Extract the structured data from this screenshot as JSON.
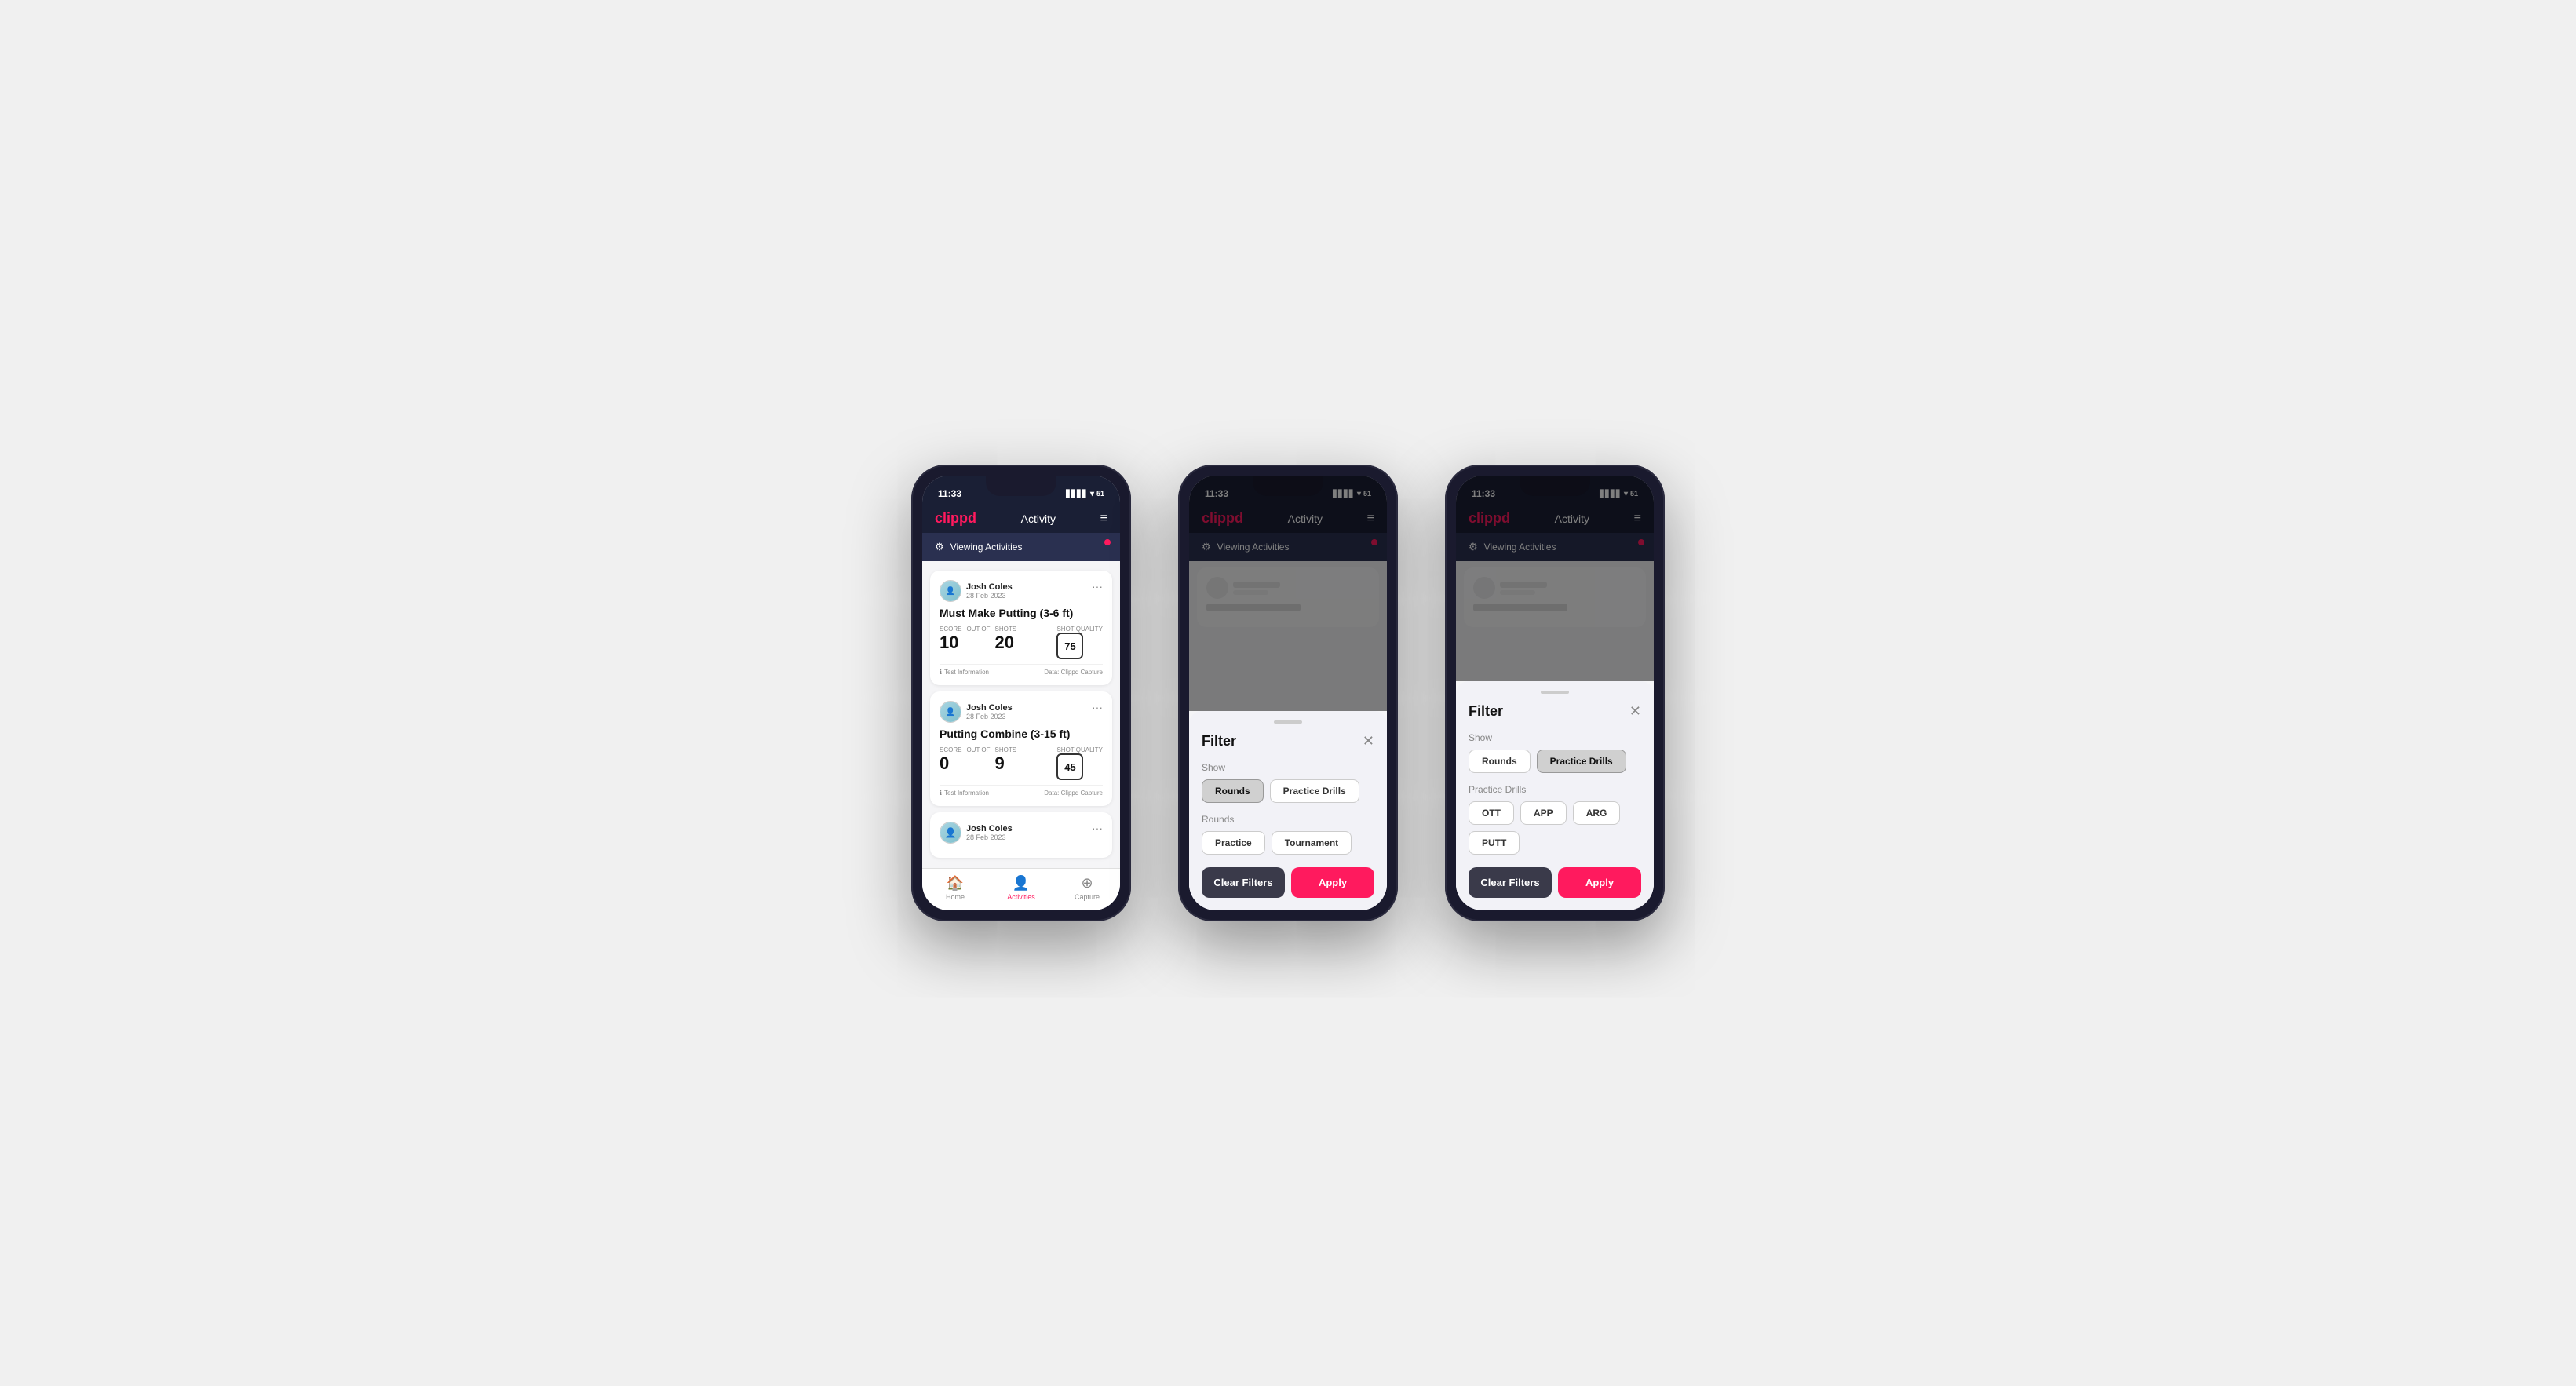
{
  "phones": [
    {
      "id": "phone1",
      "status_bar": {
        "time": "11:33",
        "battery": "51"
      },
      "header": {
        "logo": "clippd",
        "title": "Activity",
        "menu_icon": "≡"
      },
      "viewing_bar": {
        "text": "Viewing Activities",
        "has_dot": true
      },
      "cards": [
        {
          "user_name": "Josh Coles",
          "user_date": "28 Feb 2023",
          "activity_title": "Must Make Putting (3-6 ft)",
          "score_label": "Score",
          "score_value": "10",
          "shots_label": "Shots",
          "out_of_label": "OUT OF",
          "shots_value": "20",
          "shot_quality_label": "Shot Quality",
          "shot_quality_value": "75",
          "footer_left": "Test Information",
          "footer_right": "Data: Clippd Capture"
        },
        {
          "user_name": "Josh Coles",
          "user_date": "28 Feb 2023",
          "activity_title": "Putting Combine (3-15 ft)",
          "score_label": "Score",
          "score_value": "0",
          "shots_label": "Shots",
          "out_of_label": "OUT OF",
          "shots_value": "9",
          "shot_quality_label": "Shot Quality",
          "shot_quality_value": "45",
          "footer_left": "Test Information",
          "footer_right": "Data: Clippd Capture"
        },
        {
          "user_name": "Josh Coles",
          "user_date": "28 Feb 2023",
          "activity_title": "",
          "score_label": "",
          "score_value": "",
          "shots_label": "",
          "out_of_label": "",
          "shots_value": "",
          "shot_quality_label": "",
          "shot_quality_value": "",
          "footer_left": "",
          "footer_right": "",
          "partial": true
        }
      ],
      "bottom_nav": [
        {
          "icon": "🏠",
          "label": "Home",
          "active": false
        },
        {
          "icon": "👤",
          "label": "Activities",
          "active": true
        },
        {
          "icon": "⊕",
          "label": "Capture",
          "active": false
        }
      ],
      "has_filter": false
    },
    {
      "id": "phone2",
      "status_bar": {
        "time": "11:33",
        "battery": "51"
      },
      "header": {
        "logo": "clippd",
        "title": "Activity",
        "menu_icon": "≡"
      },
      "viewing_bar": {
        "text": "Viewing Activities",
        "has_dot": true
      },
      "has_filter": true,
      "filter": {
        "title": "Filter",
        "show_label": "Show",
        "chips_show": [
          {
            "label": "Rounds",
            "active": true
          },
          {
            "label": "Practice Drills",
            "active": false
          }
        ],
        "rounds_label": "Rounds",
        "chips_rounds": [
          {
            "label": "Practice",
            "active": false
          },
          {
            "label": "Tournament",
            "active": false
          }
        ],
        "practice_drills_label": "",
        "chips_practice": [],
        "clear_label": "Clear Filters",
        "apply_label": "Apply"
      }
    },
    {
      "id": "phone3",
      "status_bar": {
        "time": "11:33",
        "battery": "51"
      },
      "header": {
        "logo": "clippd",
        "title": "Activity",
        "menu_icon": "≡"
      },
      "viewing_bar": {
        "text": "Viewing Activities",
        "has_dot": true
      },
      "has_filter": true,
      "filter": {
        "title": "Filter",
        "show_label": "Show",
        "chips_show": [
          {
            "label": "Rounds",
            "active": false
          },
          {
            "label": "Practice Drills",
            "active": true
          }
        ],
        "rounds_label": "",
        "chips_rounds": [],
        "practice_drills_label": "Practice Drills",
        "chips_practice": [
          {
            "label": "OTT",
            "active": false
          },
          {
            "label": "APP",
            "active": false
          },
          {
            "label": "ARG",
            "active": false
          },
          {
            "label": "PUTT",
            "active": false
          }
        ],
        "clear_label": "Clear Filters",
        "apply_label": "Apply"
      }
    }
  ]
}
